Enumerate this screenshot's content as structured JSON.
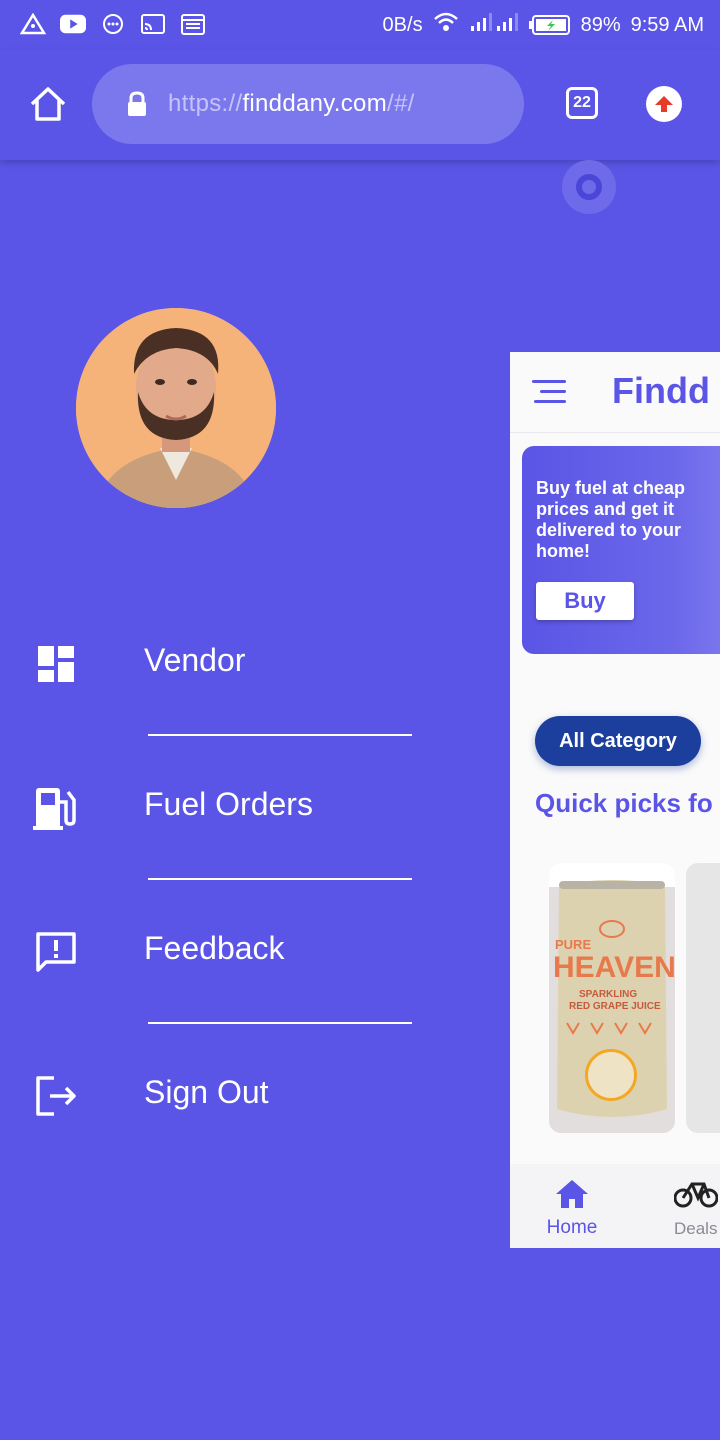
{
  "status_bar": {
    "net_speed": "0B/s",
    "battery": "89%",
    "time": "9:59 AM",
    "icons": [
      "notification-icon",
      "youtube-icon",
      "messenger-icon",
      "cast-icon",
      "calendar-icon",
      "wifi-icon",
      "signal-icon",
      "battery-icon"
    ]
  },
  "browser": {
    "url_scheme": "https://",
    "url_host": "finddany.com",
    "url_path": "/#/",
    "tab_count": "22"
  },
  "drawer": {
    "items": [
      {
        "label": "Vendor",
        "icon": "dashboard-icon"
      },
      {
        "label": "Fuel Orders",
        "icon": "fuel-pump-icon"
      },
      {
        "label": "Feedback",
        "icon": "feedback-icon"
      },
      {
        "label": "Sign Out",
        "icon": "sign-out-icon"
      }
    ]
  },
  "app": {
    "title": "Findd",
    "promo_text": "Buy fuel at cheap prices and get it delivered to your home!",
    "promo_button": "Buy",
    "category_chip": "All Category",
    "section_title": "Quick picks fo",
    "product": {
      "brand_line1": "PURE",
      "brand_line2": "HEAVEN",
      "sub_line1": "SPARKLING",
      "sub_line2": "RED GRAPE JUICE"
    },
    "nav": {
      "home_label": "Home",
      "deals_label": "Deals"
    }
  },
  "colors": {
    "primary": "#5a55e6",
    "chip": "#1c3f9e",
    "update_badge": "#e8392b"
  }
}
